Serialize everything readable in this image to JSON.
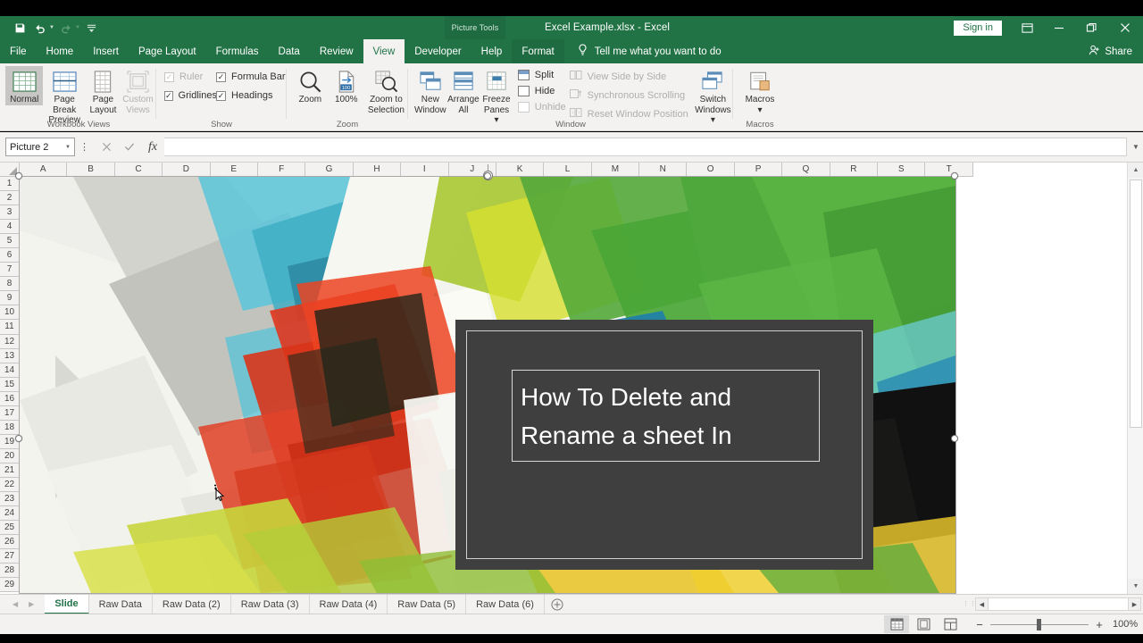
{
  "titlebar": {
    "quick_access": [
      {
        "name": "save",
        "icon": "save-icon"
      },
      {
        "name": "undo",
        "icon": "undo-icon"
      },
      {
        "name": "redo",
        "icon": "redo-icon"
      },
      {
        "name": "customize",
        "icon": "customize-qat-icon"
      }
    ],
    "context_tools_label": "Picture Tools",
    "document_title": "Excel Example.xlsx  -  Excel",
    "sign_in_label": "Sign in",
    "ribbon_display_icon": "ribbon-display-options-icon",
    "minimize_icon": "minimize-icon",
    "restore_icon": "restore-icon",
    "close_icon": "close-icon",
    "accent_color": "#217346"
  },
  "tabs": {
    "items": [
      {
        "label": "File",
        "active": false
      },
      {
        "label": "Home",
        "active": false
      },
      {
        "label": "Insert",
        "active": false
      },
      {
        "label": "Page Layout",
        "active": false
      },
      {
        "label": "Formulas",
        "active": false
      },
      {
        "label": "Data",
        "active": false
      },
      {
        "label": "Review",
        "active": false
      },
      {
        "label": "View",
        "active": true
      },
      {
        "label": "Developer",
        "active": false
      },
      {
        "label": "Help",
        "active": false
      }
    ],
    "contextual_tab": "Format",
    "tell_me_placeholder": "Tell me what you want to do",
    "share_label": "Share"
  },
  "ribbon": {
    "groups": [
      {
        "label": "Workbook Views",
        "buttons": [
          {
            "label_line1": "Normal",
            "label_line2": "",
            "selected": true,
            "disabled": false,
            "icon": "normal-view-icon"
          },
          {
            "label_line1": "Page Break",
            "label_line2": "Preview",
            "selected": false,
            "disabled": false,
            "icon": "page-break-preview-icon"
          },
          {
            "label_line1": "Page",
            "label_line2": "Layout",
            "selected": false,
            "disabled": false,
            "icon": "page-layout-icon"
          },
          {
            "label_line1": "Custom",
            "label_line2": "Views",
            "selected": false,
            "disabled": true,
            "icon": "custom-views-icon"
          }
        ]
      },
      {
        "label": "Show",
        "checkboxes": [
          {
            "label": "Ruler",
            "checked": true,
            "disabled": true
          },
          {
            "label": "Formula Bar",
            "checked": true,
            "disabled": false
          },
          {
            "label": "Gridlines",
            "checked": true,
            "disabled": false
          },
          {
            "label": "Headings",
            "checked": true,
            "disabled": false
          }
        ]
      },
      {
        "label": "Zoom",
        "buttons": [
          {
            "label_line1": "Zoom",
            "label_line2": "",
            "icon": "zoom-icon"
          },
          {
            "label_line1": "100%",
            "label_line2": "",
            "icon": "zoom-100-icon"
          },
          {
            "label_line1": "Zoom to",
            "label_line2": "Selection",
            "icon": "zoom-to-selection-icon"
          }
        ]
      },
      {
        "label": "Window",
        "buttons": [
          {
            "label_line1": "New",
            "label_line2": "Window",
            "icon": "new-window-icon"
          },
          {
            "label_line1": "Arrange",
            "label_line2": "All",
            "icon": "arrange-all-icon"
          },
          {
            "label_line1": "Freeze",
            "label_line2": "Panes ▾",
            "icon": "freeze-panes-icon"
          }
        ],
        "small_items": [
          {
            "label": "Split",
            "disabled": false
          },
          {
            "label": "Hide",
            "disabled": false
          },
          {
            "label": "Unhide",
            "disabled": true
          },
          {
            "label": "View Side by Side",
            "disabled": true
          },
          {
            "label": "Synchronous Scrolling",
            "disabled": true
          },
          {
            "label": "Reset Window Position",
            "disabled": true
          }
        ],
        "switch_windows": {
          "label_line1": "Switch",
          "label_line2": "Windows ▾",
          "icon": "switch-windows-icon"
        }
      },
      {
        "label": "Macros",
        "buttons": [
          {
            "label_line1": "Macros",
            "label_line2": "▾",
            "icon": "macros-icon"
          }
        ]
      }
    ],
    "collapse_icon": "collapse-ribbon-icon"
  },
  "formula_bar": {
    "name_box_value": "Picture 2",
    "cancel_icon": "cancel-icon",
    "enter_icon": "confirm-icon",
    "function_icon": "insert-function-icon",
    "formula_value": "",
    "expand_icon": "expand-formula-bar-icon"
  },
  "grid": {
    "columns": [
      "A",
      "B",
      "C",
      "D",
      "E",
      "F",
      "G",
      "H",
      "I",
      "J",
      "K",
      "L",
      "M",
      "N",
      "O",
      "P",
      "Q",
      "R",
      "S",
      "T"
    ],
    "rows": [
      1,
      2,
      3,
      4,
      5,
      6,
      7,
      8,
      9,
      10,
      11,
      12,
      13,
      14,
      15,
      16,
      17,
      18,
      19,
      20,
      21,
      22,
      23,
      24,
      25,
      26,
      27,
      28,
      29
    ]
  },
  "picture": {
    "name": "Picture 2",
    "selected": true,
    "slide": {
      "background_color": "#3f3f3f",
      "title_lines": [
        "How To Delete and",
        "Rename a sheet In"
      ]
    }
  },
  "sheet_tabs": {
    "prev_icon": "nav-prev-icon",
    "next_icon": "nav-next-icon",
    "items": [
      {
        "label": "Slide",
        "active": true
      },
      {
        "label": "Raw Data",
        "active": false
      },
      {
        "label": "Raw Data (2)",
        "active": false
      },
      {
        "label": "Raw Data (3)",
        "active": false
      },
      {
        "label": "Raw Data (4)",
        "active": false
      },
      {
        "label": "Raw Data (5)",
        "active": false
      },
      {
        "label": "Raw Data (6)",
        "active": false
      }
    ],
    "add_sheet_icon": "add-sheet-icon"
  },
  "status_bar": {
    "status_text": "",
    "view_buttons": [
      {
        "name": "normal-view",
        "icon": "normal-view-icon",
        "active": true
      },
      {
        "name": "page-layout-view",
        "icon": "page-layout-view-icon",
        "active": false
      },
      {
        "name": "page-break-preview-view",
        "icon": "page-break-preview-icon",
        "active": false
      }
    ],
    "zoom_out_label": "−",
    "zoom_in_label": "+",
    "zoom_level": "100%"
  }
}
